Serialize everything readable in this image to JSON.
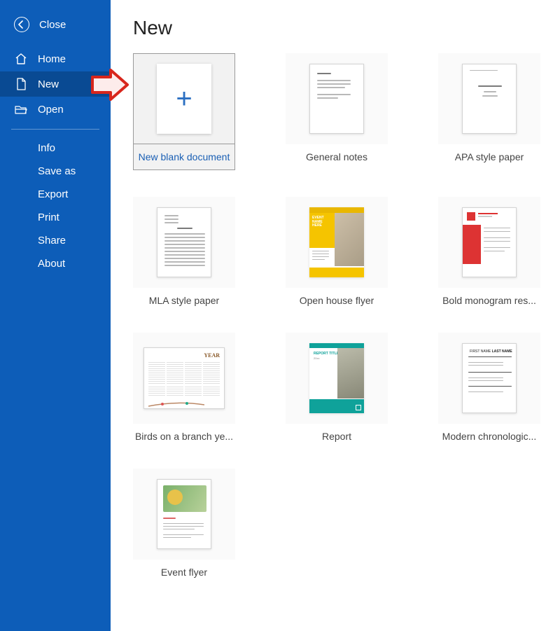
{
  "close_label": "Close",
  "nav": {
    "home": "Home",
    "new": "New",
    "open": "Open"
  },
  "sub": {
    "info": "Info",
    "save_as": "Save as",
    "export": "Export",
    "print": "Print",
    "share": "Share",
    "about": "About"
  },
  "page_title": "New",
  "templates": [
    {
      "label": "New blank document"
    },
    {
      "label": "General notes"
    },
    {
      "label": "APA style paper"
    },
    {
      "label": "MLA style paper"
    },
    {
      "label": "Open house flyer"
    },
    {
      "label": "Bold monogram res..."
    },
    {
      "label": "Birds on a branch ye..."
    },
    {
      "label": "Report"
    },
    {
      "label": "Modern chronologic..."
    },
    {
      "label": "Event flyer"
    }
  ]
}
